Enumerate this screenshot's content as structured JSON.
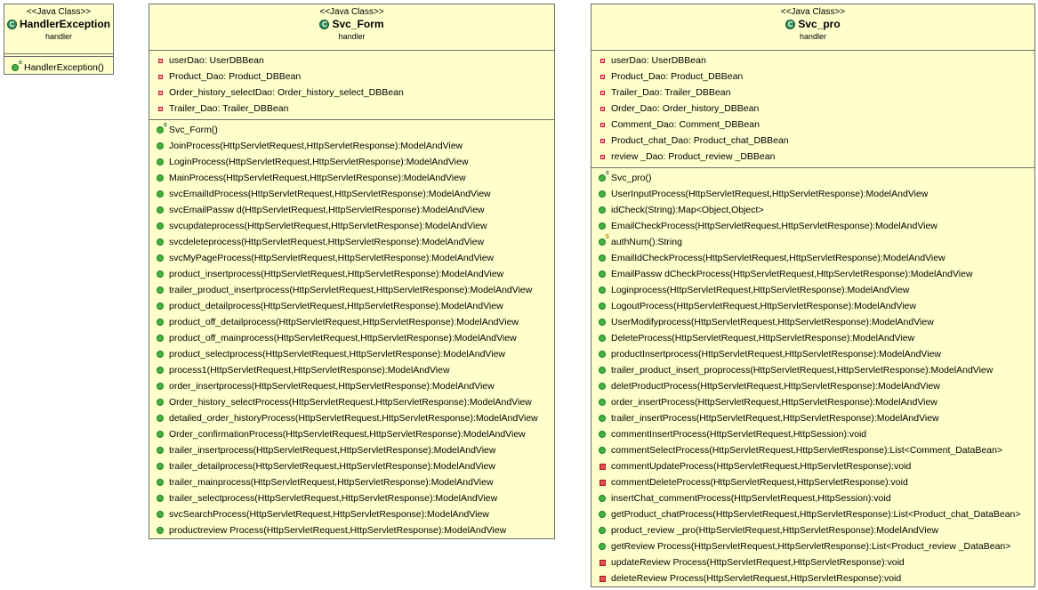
{
  "classes": {
    "handler_exception": {
      "stereotype": "<<Java Class>>",
      "name": "HandlerException",
      "package": "handler",
      "icon": "class-icon",
      "methods": [
        {
          "label": "HandlerException()",
          "kind": "constructor"
        }
      ]
    },
    "svc_form": {
      "stereotype": "<<Java Class>>",
      "name": "Svc_Form",
      "package": "handler",
      "icon": "class-icon",
      "fields": [
        {
          "label": "userDao: UserDBBean"
        },
        {
          "label": "Product_Dao: Product_DBBean"
        },
        {
          "label": "Order_history_selectDao: Order_history_select_DBBean"
        },
        {
          "label": "Trailer_Dao: Trailer_DBBean"
        }
      ],
      "methods": [
        {
          "label": "Svc_Form()",
          "kind": "constructor"
        },
        {
          "label": "JoinProcess(HttpServletRequest,HttpServletResponse):ModelAndView",
          "kind": "public"
        },
        {
          "label": "LoginProcess(HttpServletRequest,HttpServletResponse):ModelAndView",
          "kind": "public"
        },
        {
          "label": "MainProcess(HttpServletRequest,HttpServletResponse):ModelAndView",
          "kind": "public"
        },
        {
          "label": "svcEmailIdProcess(HttpServletRequest,HttpServletResponse):ModelAndView",
          "kind": "public"
        },
        {
          "label": "svcEmailPassw d(HttpServletRequest,HttpServletResponse):ModelAndView",
          "kind": "public"
        },
        {
          "label": "svcupdateprocess(HttpServletRequest,HttpServletResponse):ModelAndView",
          "kind": "public"
        },
        {
          "label": "svcdeleteprocess(HttpServletRequest,HttpServletResponse):ModelAndView",
          "kind": "public"
        },
        {
          "label": "svcMyPageProcess(HttpServletRequest,HttpServletResponse):ModelAndView",
          "kind": "public"
        },
        {
          "label": "product_insertprocess(HttpServletRequest,HttpServletResponse):ModelAndView",
          "kind": "public"
        },
        {
          "label": "trailer_product_insertprocess(HttpServletRequest,HttpServletResponse):ModelAndView",
          "kind": "public"
        },
        {
          "label": "product_detailprocess(HttpServletRequest,HttpServletResponse):ModelAndView",
          "kind": "public"
        },
        {
          "label": "product_off_detailprocess(HttpServletRequest,HttpServletResponse):ModelAndView",
          "kind": "public"
        },
        {
          "label": "product_off_mainprocess(HttpServletRequest,HttpServletResponse):ModelAndView",
          "kind": "public"
        },
        {
          "label": "product_selectprocess(HttpServletRequest,HttpServletResponse):ModelAndView",
          "kind": "public"
        },
        {
          "label": "process1(HttpServletRequest,HttpServletResponse):ModelAndView",
          "kind": "public"
        },
        {
          "label": "order_insertprocess(HttpServletRequest,HttpServletResponse):ModelAndView",
          "kind": "public"
        },
        {
          "label": "Order_history_selectProcess(HttpServletRequest,HttpServletResponse):ModelAndView",
          "kind": "public"
        },
        {
          "label": "detailed_order_historyProcess(HttpServletRequest,HttpServletResponse):ModelAndView",
          "kind": "public"
        },
        {
          "label": "Order_confirmationProcess(HttpServletRequest,HttpServletResponse):ModelAndView",
          "kind": "public"
        },
        {
          "label": "trailer_insertprocess(HttpServletRequest,HttpServletResponse):ModelAndView",
          "kind": "public"
        },
        {
          "label": "trailer_detailprocess(HttpServletRequest,HttpServletResponse):ModelAndView",
          "kind": "public"
        },
        {
          "label": "trailer_mainprocess(HttpServletRequest,HttpServletResponse):ModelAndView",
          "kind": "public"
        },
        {
          "label": "trailer_selectprocess(HttpServletRequest,HttpServletResponse):ModelAndView",
          "kind": "public"
        },
        {
          "label": "svcSearchProcess(HttpServletRequest,HttpServletResponse):ModelAndView",
          "kind": "public"
        },
        {
          "label": "productreview Process(HttpServletRequest,HttpServletResponse):ModelAndView",
          "kind": "public"
        }
      ]
    },
    "svc_pro": {
      "stereotype": "<<Java Class>>",
      "name": "Svc_pro",
      "package": "handler",
      "icon": "class-icon",
      "fields": [
        {
          "label": "userDao: UserDBBean"
        },
        {
          "label": "Product_Dao: Product_DBBean"
        },
        {
          "label": "Trailer_Dao: Trailer_DBBean"
        },
        {
          "label": "Order_Dao: Order_history_DBBean"
        },
        {
          "label": "Comment_Dao: Comment_DBBean"
        },
        {
          "label": "Product_chat_Dao: Product_chat_DBBean"
        },
        {
          "label": "review _Dao: Product_review _DBBean"
        }
      ],
      "methods": [
        {
          "label": "Svc_pro()",
          "kind": "constructor"
        },
        {
          "label": "UserInputProcess(HttpServletRequest,HttpServletResponse):ModelAndView",
          "kind": "public"
        },
        {
          "label": "idCheck(String):Map<Object,Object>",
          "kind": "public"
        },
        {
          "label": "EmailCheckProcess(HttpServletRequest,HttpServletResponse):ModelAndView",
          "kind": "public"
        },
        {
          "label": "authNum():String",
          "kind": "static"
        },
        {
          "label": "EmailIdCheckProcess(HttpServletRequest,HttpServletResponse):ModelAndView",
          "kind": "public"
        },
        {
          "label": "EmailPassw dCheckProcess(HttpServletRequest,HttpServletResponse):ModelAndView",
          "kind": "public"
        },
        {
          "label": "Loginprocess(HttpServletRequest,HttpServletResponse):ModelAndView",
          "kind": "public"
        },
        {
          "label": "LogoutProcess(HttpServletRequest,HttpServletResponse):ModelAndView",
          "kind": "public"
        },
        {
          "label": "UserModifyprocess(HttpServletRequest,HttpServletResponse):ModelAndView",
          "kind": "public"
        },
        {
          "label": "DeleteProcess(HttpServletRequest,HttpServletResponse):ModelAndView",
          "kind": "public"
        },
        {
          "label": "productInsertprocess(HttpServletRequest,HttpServletResponse):ModelAndView",
          "kind": "public"
        },
        {
          "label": "trailer_product_insert_proprocess(HttpServletRequest,HttpServletResponse):ModelAndView",
          "kind": "public"
        },
        {
          "label": "deletProductProcess(HttpServletRequest,HttpServletResponse):ModelAndView",
          "kind": "public"
        },
        {
          "label": "order_insertProcess(HttpServletRequest,HttpServletResponse):ModelAndView",
          "kind": "public"
        },
        {
          "label": "trailer_insertProcess(HttpServletRequest,HttpServletResponse):ModelAndView",
          "kind": "public"
        },
        {
          "label": "commentInsertProcess(HttpServletRequest,HttpSession):void",
          "kind": "public"
        },
        {
          "label": "commentSelectProcess(HttpServletRequest,HttpServletResponse):List<Comment_DataBean>",
          "kind": "public"
        },
        {
          "label": "commentUpdateProcess(HttpServletRequest,HttpServletResponse):void",
          "kind": "private"
        },
        {
          "label": "commentDeleteProcess(HttpServletRequest,HttpServletResponse):void",
          "kind": "private"
        },
        {
          "label": "insertChat_commentProcess(HttpServletRequest,HttpSession):void",
          "kind": "public"
        },
        {
          "label": "getProduct_chatProcess(HttpServletRequest,HttpServletResponse):List<Product_chat_DataBean>",
          "kind": "public"
        },
        {
          "label": "product_review _pro(HttpServletRequest,HttpServletResponse):ModelAndView",
          "kind": "public"
        },
        {
          "label": "getReview Process(HttpServletRequest,HttpServletResponse):List<Product_review _DataBean>",
          "kind": "public"
        },
        {
          "label": "updateReview Process(HttpServletRequest,HttpServletResponse):void",
          "kind": "private"
        },
        {
          "label": "deleteReview Process(HttpServletRequest,HttpServletResponse):void",
          "kind": "private"
        }
      ]
    }
  }
}
